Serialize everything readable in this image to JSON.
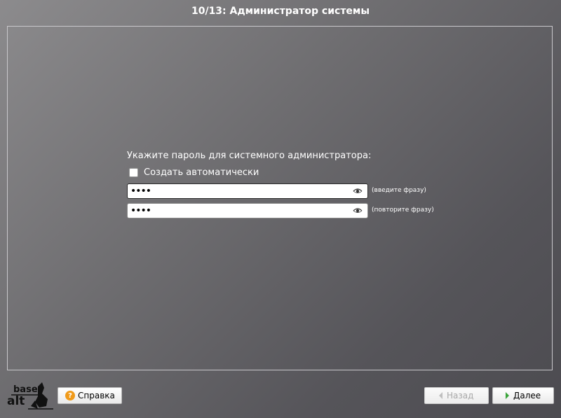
{
  "header": {
    "title": "10/13: Администратор системы"
  },
  "form": {
    "prompt": "Укажите пароль для системного администратора:",
    "auto_checkbox_label": "Создать автоматически",
    "auto_checked": false,
    "password_value": "••••",
    "password_hint": "(введите фразу)",
    "confirm_value": "••••",
    "confirm_hint": "(повторите фразу)"
  },
  "footer": {
    "logo_text_top": "base",
    "logo_text_bottom": "alt",
    "help_label": "Справка",
    "back_label": "Назад",
    "next_label": "Далее"
  },
  "icons": [
    "eye-icon",
    "help-icon",
    "arrow-left-icon",
    "arrow-right-icon"
  ],
  "colors": {
    "accent_help": "#f09a1a",
    "accent_next": "#3aa43a"
  }
}
